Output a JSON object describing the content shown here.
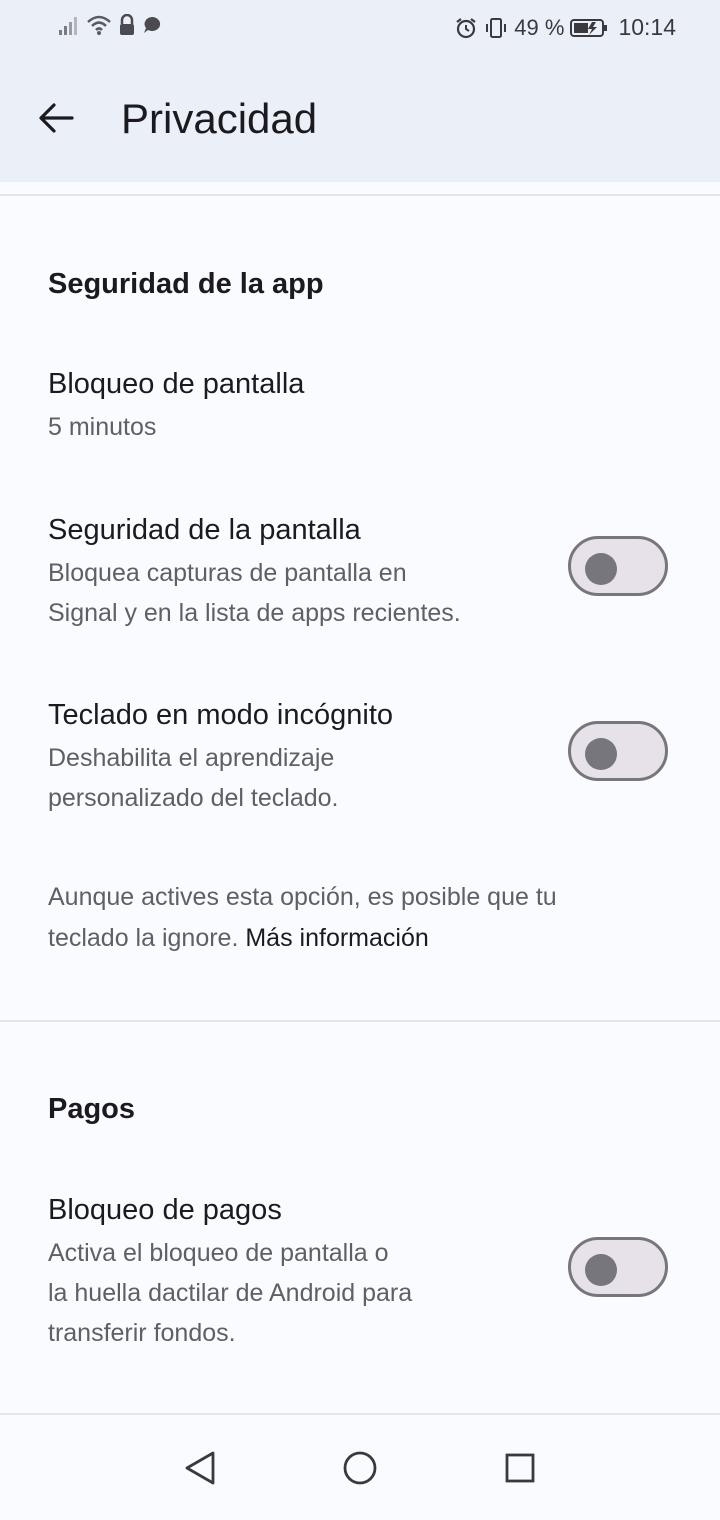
{
  "status_bar": {
    "battery": "49 %",
    "time": "10:14"
  },
  "header": {
    "title": "Privacidad"
  },
  "sections": {
    "app_security": {
      "title": "Seguridad de la app",
      "screen_lock": {
        "title": "Bloqueo de pantalla",
        "value": "5 minutos"
      },
      "screen_security": {
        "title": "Seguridad de la pantalla",
        "desc_line1": "Bloquea capturas de pantalla en",
        "desc_line2": "Signal y en la lista de apps recientes.",
        "enabled": false
      },
      "incognito_keyboard": {
        "title": "Teclado en modo incógnito",
        "desc_line1": "Deshabilita el aprendizaje",
        "desc_line2": "personalizado del teclado.",
        "enabled": false
      },
      "note": {
        "line1": "Aunque actives esta opción, es posible que tu",
        "line2": "teclado la ignore.",
        "link": "Más información"
      }
    },
    "payments": {
      "title": "Pagos",
      "payment_lock": {
        "title": "Bloqueo de pagos",
        "desc_line1": "Activa el bloqueo de pantalla o",
        "desc_line2": "la huella dactilar de Android para",
        "desc_line3": "transferir fondos.",
        "enabled": false
      }
    }
  },
  "icons": {
    "back": "arrow-back-icon",
    "nav_back": "triangle-back-icon",
    "nav_home": "circle-home-icon",
    "nav_recents": "square-recents-icon"
  },
  "colors": {
    "app_bar": "#ebeff8",
    "background": "#fafbff",
    "toggle_track": "#e7e1e9",
    "toggle_outline": "#77767d"
  }
}
